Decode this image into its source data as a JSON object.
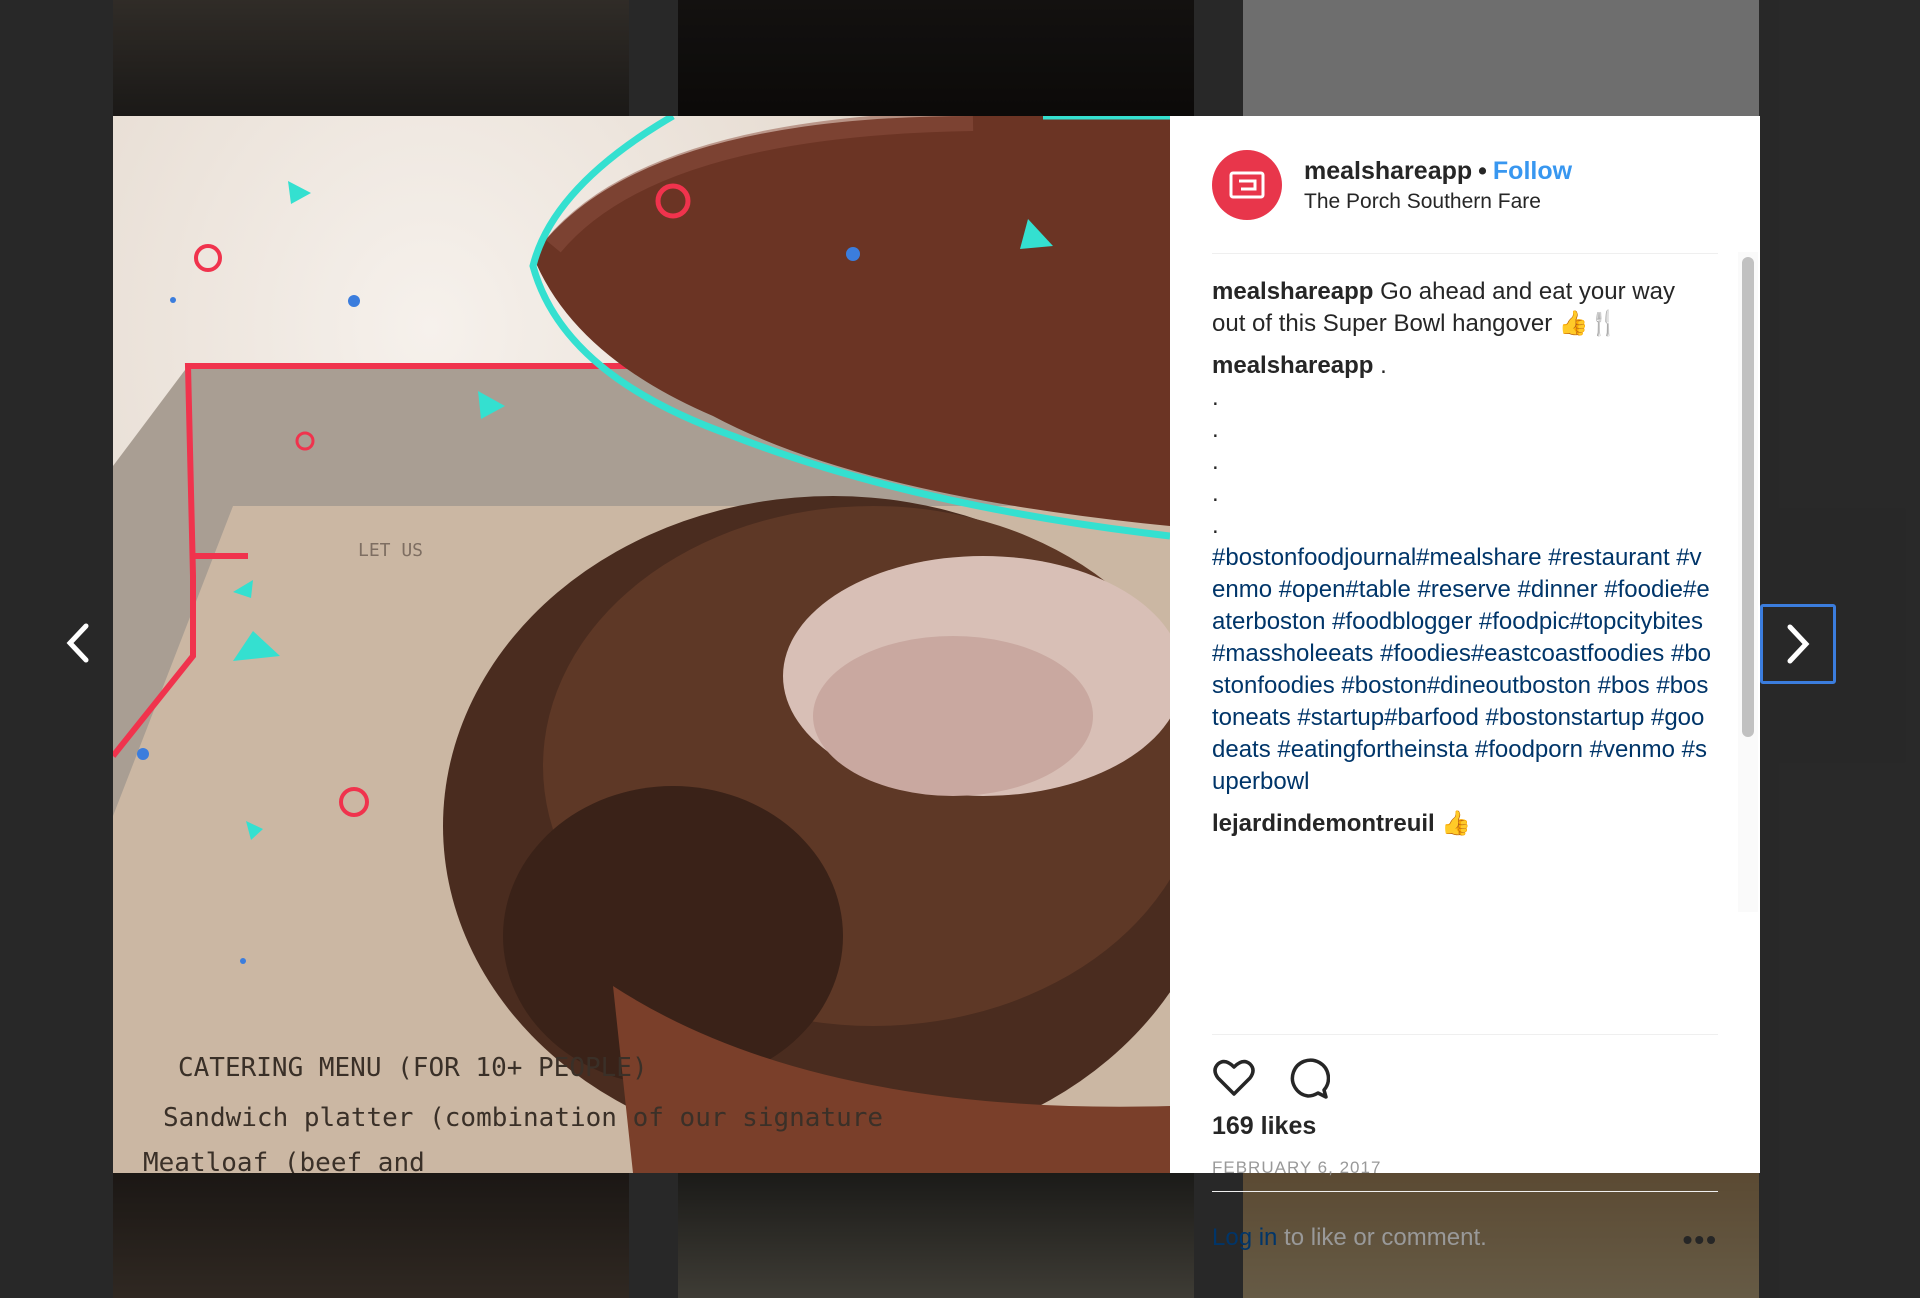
{
  "post": {
    "username": "mealshareapp",
    "separator": "•",
    "follow_label": "Follow",
    "location": "The Porch Southern Fare",
    "caption_user": "mealshareapp",
    "caption_text": "Go ahead and eat your way out of this Super Bowl hangover 👍🍴",
    "second_user": "mealshareapp",
    "second_text": ".",
    "dots": [
      ".",
      ".",
      ".",
      ".",
      "."
    ],
    "hashtags": "#bostonfoodjournal#mealshare #restaurant #venmo #open#table #reserve #dinner #foodie#eaterboston #foodblogger #foodpic#topcitybites #massholeeats #foodies#eastcoastfoodies #bostonfoodies #boston#dineoutboston #bos #bostoneats #startup#barfood #bostonstartup #goodeats #eatingfortheinsta #foodporn #venmo #superbowl",
    "comment3_user": "lejardindemontreuil",
    "comment3_text": "👍",
    "likes": "169 likes",
    "date": "FEBRUARY 6, 2017",
    "login_label": "Log in",
    "login_suffix": " to like or comment.",
    "more_label": "•••"
  },
  "photo_text": {
    "menu_line1": "CATERING MENU  (FOR 10+ PEOPLE)",
    "menu_line2": "Sandwich platter (combination of our signature",
    "menu_line3": "Meatloaf (beef and",
    "paper_note": "LET US"
  },
  "icons": {
    "prev": "chevron-left-icon",
    "next": "chevron-right-icon",
    "like": "heart-icon",
    "comment": "comment-bubble-icon",
    "avatar": "mealshare-logo-icon"
  },
  "colors": {
    "accent_blue": "#3897f0",
    "hashtag_blue": "#003569",
    "brand_red": "#e8364b",
    "cyan": "#34e0d0"
  }
}
